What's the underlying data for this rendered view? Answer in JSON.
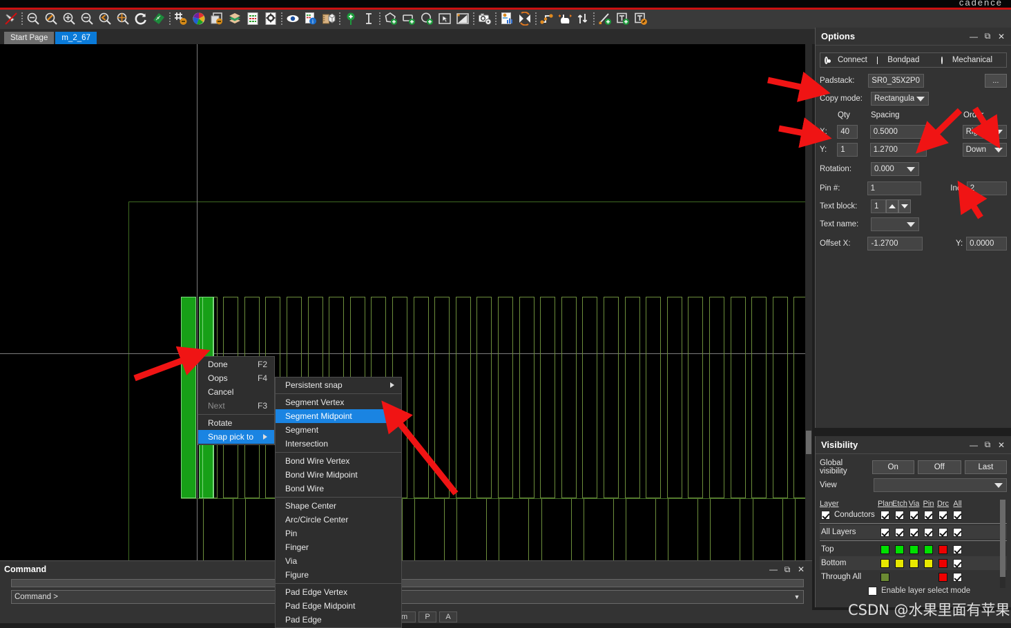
{
  "app": {
    "brand": "cadence"
  },
  "toolbar": {
    "groups": [
      {
        "items": [
          {
            "icon": "pin-off-icon",
            "name": "toggle-pin"
          }
        ]
      },
      {
        "items": [
          {
            "icon": "zoom-fit-icon",
            "name": "zoom-fit"
          },
          {
            "icon": "zoom-select-icon",
            "name": "zoom-by-points"
          },
          {
            "icon": "zoom-in-icon",
            "name": "zoom-in"
          },
          {
            "icon": "zoom-out-icon",
            "name": "zoom-out"
          },
          {
            "icon": "zoom-previous-icon",
            "name": "zoom-previous"
          },
          {
            "icon": "zoom-center-icon",
            "name": "zoom-center"
          },
          {
            "icon": "refresh-icon",
            "name": "redraw"
          },
          {
            "icon": "board-icon",
            "name": "board-view"
          }
        ]
      },
      {
        "items": [
          {
            "icon": "grid-toggle-icon",
            "name": "grid-toggle"
          },
          {
            "icon": "color-wheel-icon",
            "name": "color-visibility"
          },
          {
            "icon": "subdrawing-icon",
            "name": "sub-drawing"
          },
          {
            "icon": "layers-icon",
            "name": "layers"
          },
          {
            "icon": "spreadsheet-icon",
            "name": "constraint-manager"
          },
          {
            "icon": "settings-doc-icon",
            "name": "design-parameters"
          }
        ]
      },
      {
        "items": [
          {
            "icon": "eye-icon",
            "name": "show-element"
          },
          {
            "icon": "report-info-icon",
            "name": "element-report"
          },
          {
            "icon": "measure-icon",
            "name": "measure"
          }
        ]
      },
      {
        "items": [
          {
            "icon": "add-pin-icon",
            "name": "add-pin"
          },
          {
            "icon": "text-cursor-icon",
            "name": "add-text"
          }
        ]
      },
      {
        "items": [
          {
            "icon": "add-shape-icon",
            "name": "shape-add-polygon"
          },
          {
            "icon": "add-rect-icon",
            "name": "shape-add-rect"
          },
          {
            "icon": "add-circle-icon",
            "name": "shape-add-circle"
          },
          {
            "icon": "select-shape-icon",
            "name": "shape-select"
          },
          {
            "icon": "shape-fill-icon",
            "name": "shape-change-fill"
          }
        ]
      },
      {
        "items": [
          {
            "icon": "snapshot-icon",
            "name": "snapshot"
          }
        ]
      },
      {
        "items": [
          {
            "icon": "chart-report-icon",
            "name": "reports"
          },
          {
            "icon": "swap-icon",
            "name": "swap"
          }
        ]
      },
      {
        "items": [
          {
            "icon": "route-icon",
            "name": "route-connect"
          },
          {
            "icon": "slide-icon",
            "name": "slide"
          },
          {
            "icon": "updown-icon",
            "name": "change-layer"
          }
        ]
      },
      {
        "items": [
          {
            "icon": "add-line-icon",
            "name": "add-line"
          },
          {
            "icon": "add-text-box-icon",
            "name": "add-text-box"
          },
          {
            "icon": "edit-text-icon",
            "name": "edit-text"
          }
        ]
      }
    ]
  },
  "tabs": [
    {
      "label": "Start Page",
      "active": false
    },
    {
      "label": "m_2_67",
      "active": true
    }
  ],
  "command_panel": {
    "title": "Command",
    "prompt": "Command >",
    "history_value": "",
    "window_buttons": [
      "minimize",
      "restore",
      "close"
    ]
  },
  "status_bar": {
    "units": "mm",
    "cells": [
      "mm",
      "P",
      "A"
    ]
  },
  "options": {
    "title": "Options",
    "window_buttons": [
      "minimize",
      "restore",
      "close"
    ],
    "mode": {
      "connect": "Connect",
      "bondpad": "Bondpad",
      "mechanical": "Mechanical",
      "selected": "Connect"
    },
    "padstack_label": "Padstack:",
    "padstack_value": "SR0_35X2P0",
    "browse_button": "...",
    "copy_mode_label": "Copy mode:",
    "copy_mode_value": "Rectangular",
    "col_headers": {
      "qty": "Qty",
      "spacing": "Spacing",
      "order": "Order"
    },
    "rows": [
      {
        "axis": "X:",
        "qty": "40",
        "spacing": "0.5000",
        "order": "Right"
      },
      {
        "axis": "Y:",
        "qty": "1",
        "spacing": "1.2700",
        "order": "Down"
      }
    ],
    "rotation_label": "Rotation:",
    "rotation_value": "0.000",
    "pin_label": "Pin #:",
    "pin_value": "1",
    "inc_label": "Inc:",
    "inc_value": "2",
    "text_block_label": "Text block:",
    "text_block_value": "1",
    "text_name_label": "Text name:",
    "text_name_value": "",
    "offset_x_label": "Offset X:",
    "offset_x_value": "-1.2700",
    "offset_y_label": "Y:",
    "offset_y_value": "0.0000"
  },
  "visibility": {
    "title": "Visibility",
    "window_buttons": [
      "minimize",
      "restore",
      "close"
    ],
    "global_label": "Global visibility",
    "global_buttons": [
      "On",
      "Off",
      "Last"
    ],
    "view_label": "View",
    "view_value": "",
    "columns": [
      "Layer",
      "Plan",
      "Etch",
      "Via",
      "Pin",
      "Drc",
      "All"
    ],
    "rows": [
      {
        "name": "Conductors",
        "has_row_check": true,
        "cells": [
          {
            "type": "check"
          },
          {
            "type": "check"
          },
          {
            "type": "check"
          },
          {
            "type": "check"
          },
          {
            "type": "check"
          },
          {
            "type": "check"
          }
        ]
      },
      {
        "name": "All Layers",
        "has_row_check": false,
        "cells": [
          {
            "type": "check"
          },
          {
            "type": "check"
          },
          {
            "type": "check"
          },
          {
            "type": "check"
          },
          {
            "type": "check"
          },
          {
            "type": "check"
          }
        ]
      },
      {
        "name": "Top",
        "has_row_check": false,
        "cells": [
          {
            "type": "color",
            "color": "#00e000"
          },
          {
            "type": "color",
            "color": "#00e000"
          },
          {
            "type": "color",
            "color": "#00e000"
          },
          {
            "type": "color",
            "color": "#00e000"
          },
          {
            "type": "color",
            "color": "#ee0000"
          },
          {
            "type": "check"
          }
        ]
      },
      {
        "name": "Bottom",
        "has_row_check": false,
        "cells": [
          {
            "type": "color",
            "color": "#e8e800"
          },
          {
            "type": "color",
            "color": "#e8e800"
          },
          {
            "type": "color",
            "color": "#e8e800"
          },
          {
            "type": "color",
            "color": "#e8e800"
          },
          {
            "type": "color",
            "color": "#ee0000"
          },
          {
            "type": "check"
          }
        ]
      },
      {
        "name": "Through All",
        "has_row_check": false,
        "cells": [
          {
            "type": "color",
            "color": "#6b8a33"
          },
          {
            "type": "empty"
          },
          {
            "type": "empty"
          },
          {
            "type": "empty"
          },
          {
            "type": "color",
            "color": "#ee0000"
          },
          {
            "type": "check"
          }
        ]
      }
    ],
    "layer_select_label": "Enable layer select mode",
    "layer_select_checked": false
  },
  "context_menu": {
    "primary": [
      {
        "label": "Done",
        "accel": "F2",
        "state": "normal"
      },
      {
        "label": "Oops",
        "accel": "F4",
        "state": "normal"
      },
      {
        "label": "Cancel",
        "accel": "",
        "state": "normal"
      },
      {
        "label": "Next",
        "accel": "F3",
        "state": "disabled"
      },
      {
        "separator": true
      },
      {
        "label": "Rotate",
        "accel": "",
        "state": "normal"
      },
      {
        "label": "Snap pick to",
        "accel": "",
        "state": "selected",
        "submenu": true
      }
    ],
    "submenu": [
      {
        "label": "Persistent snap",
        "state": "normal",
        "submenu": true
      },
      {
        "separator": true
      },
      {
        "label": "Segment Vertex",
        "state": "normal"
      },
      {
        "label": "Segment Midpoint",
        "state": "selected"
      },
      {
        "label": "Segment",
        "state": "normal"
      },
      {
        "label": "Intersection",
        "state": "normal"
      },
      {
        "separator": true
      },
      {
        "label": "Bond Wire Vertex",
        "state": "normal"
      },
      {
        "label": "Bond Wire Midpoint",
        "state": "normal"
      },
      {
        "label": "Bond Wire",
        "state": "normal"
      },
      {
        "separator": true
      },
      {
        "label": "Shape Center",
        "state": "normal"
      },
      {
        "label": "Arc/Circle Center",
        "state": "normal"
      },
      {
        "label": "Pin",
        "state": "normal"
      },
      {
        "label": "Finger",
        "state": "normal"
      },
      {
        "label": "Via",
        "state": "normal"
      },
      {
        "label": "Figure",
        "state": "normal"
      },
      {
        "separator": true
      },
      {
        "label": "Pad Edge Vertex",
        "state": "normal"
      },
      {
        "label": "Pad Edge Midpoint",
        "state": "normal"
      },
      {
        "label": "Pad Edge",
        "state": "normal"
      }
    ]
  },
  "canvas": {
    "pad_count": 40,
    "pad_color_selected": "#17a017",
    "pad_outline_color": "#6d8f3c",
    "crosshair_color": "#7d7d7d"
  },
  "watermark": "CSDN @水果里面有苹果",
  "colors": {
    "accent_blue": "#1a84e2",
    "annotation_red": "#f01414",
    "panel_bg": "#333333",
    "toolbar_bg": "#3a3a3a",
    "brand_red": "#cc1111"
  }
}
